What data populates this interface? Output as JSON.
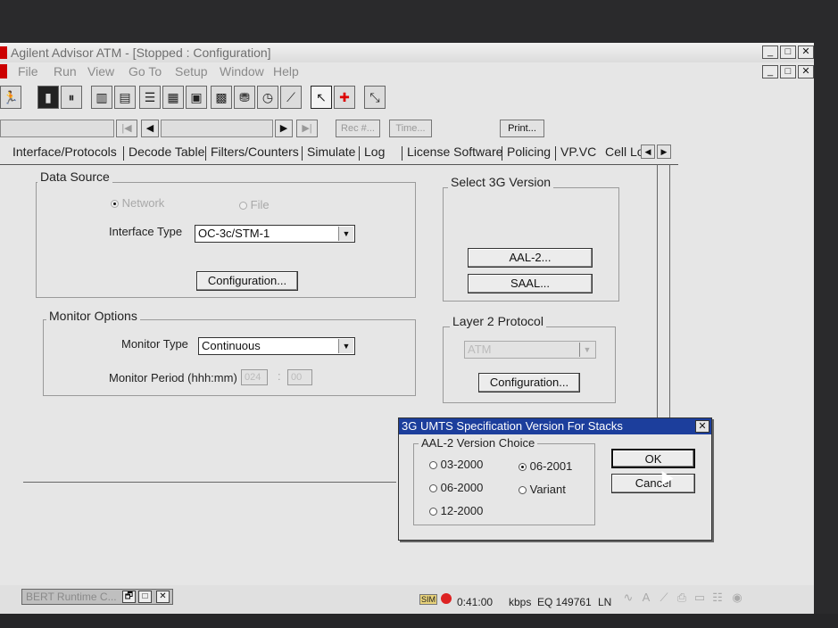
{
  "window": {
    "title": "Agilent Advisor ATM - [Stopped : Configuration]",
    "controls": [
      "_",
      "□",
      "✕"
    ]
  },
  "menu": [
    "File",
    "Run",
    "View",
    "Go To",
    "Setup",
    "Window",
    "Help"
  ],
  "navbar": {
    "rec_label": "Rec #...",
    "time_label": "Time...",
    "print_label": "Print..."
  },
  "tabs": [
    "Interface/Protocols",
    "Decode Table",
    "Filters/Counters",
    "Simulate",
    "Log",
    "License Software",
    "Policing",
    "VP.VC",
    "Cell Lo"
  ],
  "data_source": {
    "label": "Data Source",
    "network": "Network",
    "file": "File",
    "interface_type_label": "Interface Type",
    "interface_type_value": "OC-3c/STM-1",
    "config_button": "Configuration..."
  },
  "monitor_options": {
    "label": "Monitor Options",
    "monitor_type_label": "Monitor Type",
    "monitor_type_value": "Continuous",
    "monitor_period_label": "Monitor Period (hhh:mm)",
    "period_hours": "024",
    "period_sep": ":",
    "period_minutes": "00"
  },
  "select_3g": {
    "label": "Select 3G Version",
    "aal2_button": "AAL-2...",
    "saal_button": "SAAL..."
  },
  "layer2": {
    "label": "Layer 2 Protocol",
    "value": "ATM",
    "config_button": "Configuration..."
  },
  "dialog": {
    "title": "3G UMTS Specification Version For Stacks",
    "group_label": "AAL-2 Version Choice",
    "options": [
      "03-2000",
      "06-2001",
      "06-2000",
      "Variant",
      "12-2000"
    ],
    "selected": "06-2001",
    "ok": "OK",
    "cancel": "Cancel"
  },
  "status": {
    "min_window_title": "BERT Runtime C...",
    "sim": "SIM",
    "time": "0:41:00",
    "kbps": "kbps",
    "eq": "EQ 149761",
    "ln": "LN"
  }
}
